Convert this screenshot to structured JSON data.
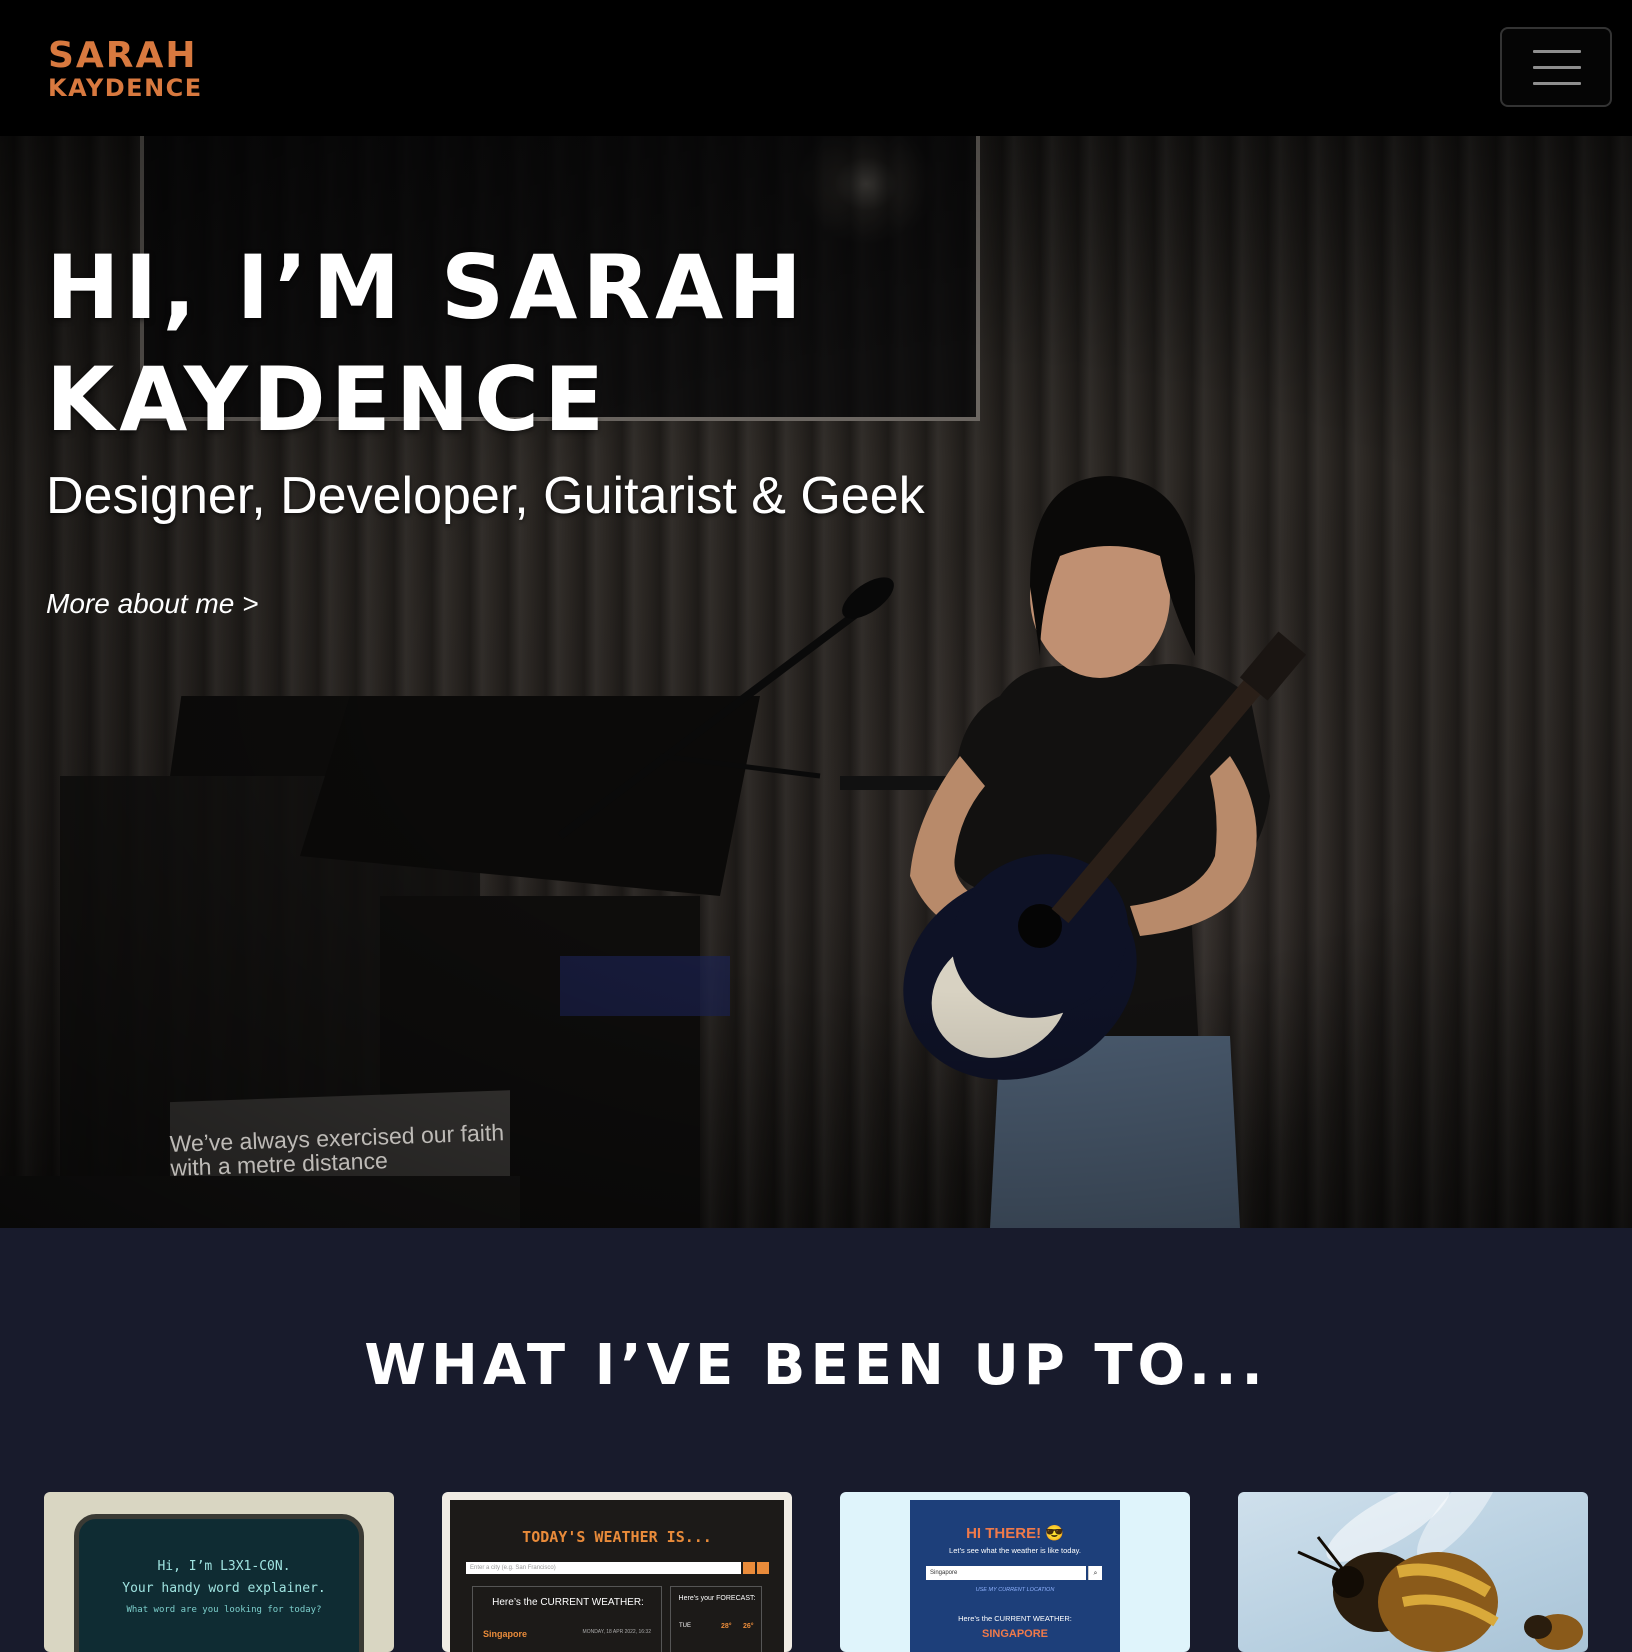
{
  "navbar": {
    "logo_line1": "SARAH",
    "logo_line2": "KAYDENCE",
    "menu_icon": "hamburger-menu-icon",
    "brand_color": "#d8793f"
  },
  "hero": {
    "title_line1": "Hi, I’m Sarah",
    "title_line2": "Kaydence",
    "subtitle": "Designer, Developer, Guitarist & Geek",
    "link_label": "More about me >",
    "banner_line1": "We’ve always exercised our faith",
    "banner_line2": "with a metre distance"
  },
  "section": {
    "title": "What I’ve been up to...",
    "background": "#181b2c"
  },
  "cards": [
    {
      "line1": "Hi, I’m L3X1-C0N.",
      "line2": "Your handy word explainer.",
      "line3": "What word are you looking for today?"
    },
    {
      "title": "TODAY'S WEATHER IS...",
      "input_placeholder": "Enter a city (e.g. San Francisco)",
      "current_label": "Here’s the CURRENT WEATHER:",
      "city": "Singapore",
      "date": "MONDAY, 18 APR 2022, 16:32",
      "forecast_label": "Here’s your FORECAST:",
      "forecast_day": "TUE",
      "forecast_hi": "28°",
      "forecast_lo": "26°"
    },
    {
      "title": "HI THERE! 😎",
      "subtitle": "Let’s see what the weather is like today.",
      "input_value": "Singapore",
      "location_link": "USE MY CURRENT LOCATION",
      "current_label": "Here’s the CURRENT WEATHER:",
      "city": "SINGAPORE"
    },
    {
      "image": "bee-photo"
    }
  ]
}
